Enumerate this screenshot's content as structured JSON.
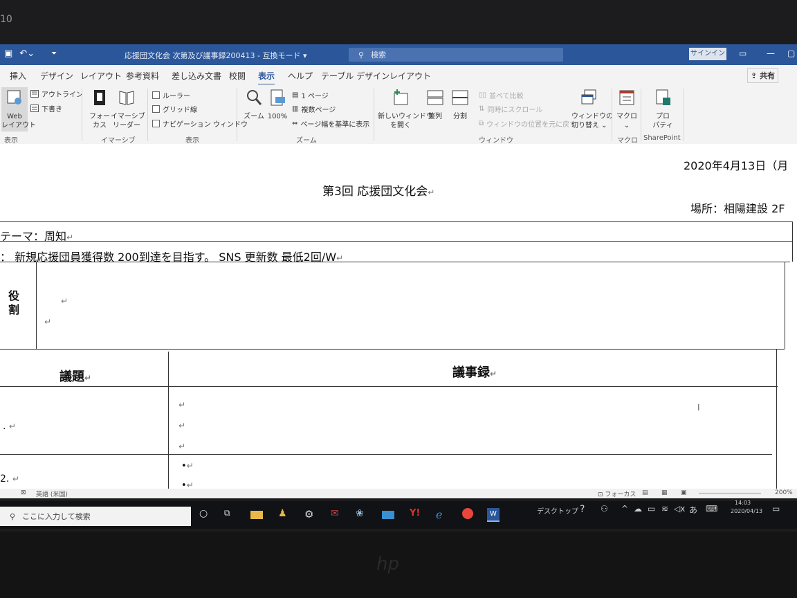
{
  "titlebar": {
    "doc_title": "応援団文化会  次第及び議事録200413  -  互換モード  ▾",
    "search_placeholder": "検索",
    "signin": "サインイン"
  },
  "tabs": [
    "挿入",
    "デザイン",
    "レイアウト",
    "参考資料",
    "差し込み文書",
    "校閲",
    "表示",
    "ヘルプ",
    "テーブル デザイン",
    "レイアウト"
  ],
  "share": "共有",
  "ribbon": {
    "view_group": {
      "web_layout": "Web\nレイアウト",
      "outline": "アウトライン",
      "draft": "下書き",
      "label": "表示"
    },
    "immersive_group": {
      "focus": "フォー\nカス",
      "immersive_reader": "イマーシブ\nリーダー",
      "label": "イマーシブ"
    },
    "show_group": {
      "ruler": "ルーラー",
      "gridlines": "グリッド線",
      "nav_pane": "ナビゲーション ウィンドウ",
      "label": "表示"
    },
    "zoom_group": {
      "zoom": "ズーム",
      "hundred": "100%",
      "one_page": "1 ページ",
      "multi_page": "複数ページ",
      "page_width": "ページ幅を基準に表示",
      "label": "ズーム"
    },
    "window_group": {
      "new_window": "新しいウィンドウ\nを開く",
      "arrange": "整列",
      "split": "分割",
      "side_by_side": "並べて比較",
      "sync_scroll": "同時にスクロール",
      "reset_pos": "ウィンドウの位置を元に戻す",
      "switch": "ウィンドウの\n切り替え ⌄",
      "label": "ウィンドウ"
    },
    "macro_group": {
      "macro": "マクロ\n⌄",
      "label": "マクロ"
    },
    "sharepoint_group": {
      "props": "プロ\nパティ",
      "label": "SharePoint"
    }
  },
  "document": {
    "date": "2020年4月13日（月",
    "title": "第3回   応援団文化会",
    "location": "場所：相陽建設 2F",
    "theme": "テーマ：周知",
    "goal": "：  新規応援団員獲得数   200到達を目指す。    SNS 更新数   最低2回/W",
    "role": "役\n割",
    "col_agenda": "議題",
    "col_minutes": "議事録",
    "row1_no": ".",
    "row2_no": "2.",
    "bullet": "•"
  },
  "statusbar": {
    "lang": "英語 (米国)",
    "focus": "フォーカス",
    "zoom": "200%"
  },
  "taskbar": {
    "search_placeholder": "ここに入力して検索",
    "desktop": "デスクトップ",
    "time": "14:03",
    "date": "2020/04/13"
  },
  "colors": {
    "word_blue": "#2b579a",
    "ribbon_bg": "#f3f3f3",
    "taskbar": "#101215"
  }
}
